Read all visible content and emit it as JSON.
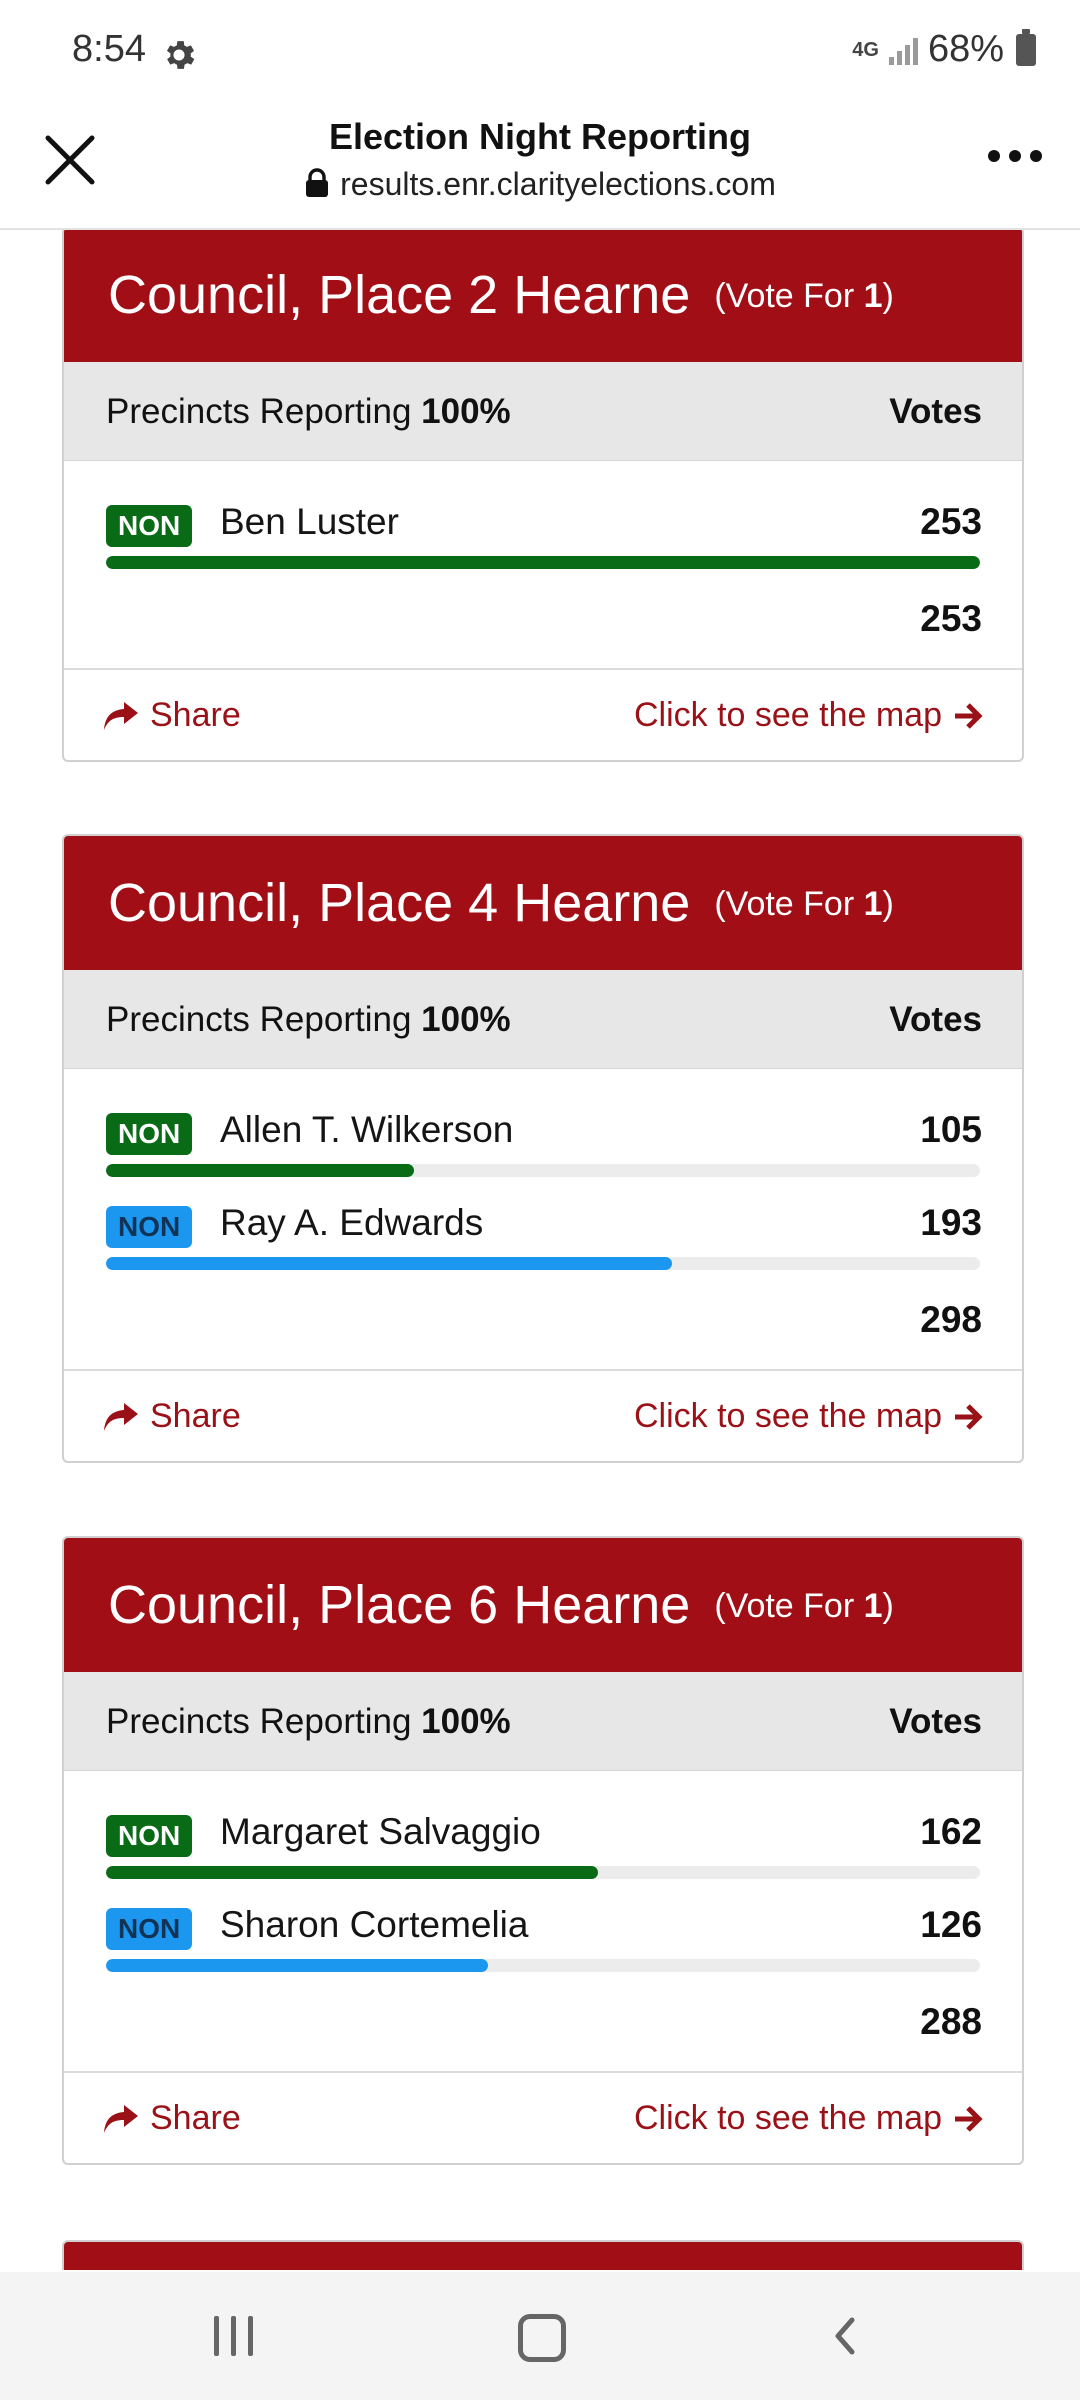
{
  "status_bar": {
    "time": "8:54",
    "network": "4G",
    "battery": "68%"
  },
  "browser": {
    "title": "Election Night Reporting",
    "url": "results.enr.clarityelections.com"
  },
  "colors": {
    "header_red": "#a20e16",
    "link_red": "#9a1117",
    "party_green": "#0a6b16",
    "party_blue": "#1c97f0"
  },
  "common": {
    "precincts_label": "Precincts Reporting",
    "votes_header": "Votes",
    "share_label": "Share",
    "map_label": "Click to see the map",
    "vote_for_label": "(Vote For",
    "vote_for_close": ")"
  },
  "contests": [
    {
      "title": "Council, Place 2 Hearne",
      "vote_for": "1",
      "precincts_pct": "100%",
      "total": "253",
      "candidates": [
        {
          "party": "NON",
          "name": "Ben Luster",
          "votes": "253",
          "share": 1.0,
          "color": "green"
        }
      ]
    },
    {
      "title": "Council, Place 4 Hearne",
      "vote_for": "1",
      "precincts_pct": "100%",
      "total": "298",
      "candidates": [
        {
          "party": "NON",
          "name": "Allen T. Wilkerson",
          "votes": "105",
          "share": 0.352,
          "color": "green"
        },
        {
          "party": "NON",
          "name": "Ray A. Edwards",
          "votes": "193",
          "share": 0.648,
          "color": "blue"
        }
      ]
    },
    {
      "title": "Council, Place 6 Hearne",
      "vote_for": "1",
      "precincts_pct": "100%",
      "total": "288",
      "candidates": [
        {
          "party": "NON",
          "name": "Margaret Salvaggio",
          "votes": "162",
          "share": 0.5625,
          "color": "green"
        },
        {
          "party": "NON",
          "name": "Sharon Cortemelia",
          "votes": "126",
          "share": 0.4375,
          "color": "blue"
        }
      ]
    }
  ]
}
